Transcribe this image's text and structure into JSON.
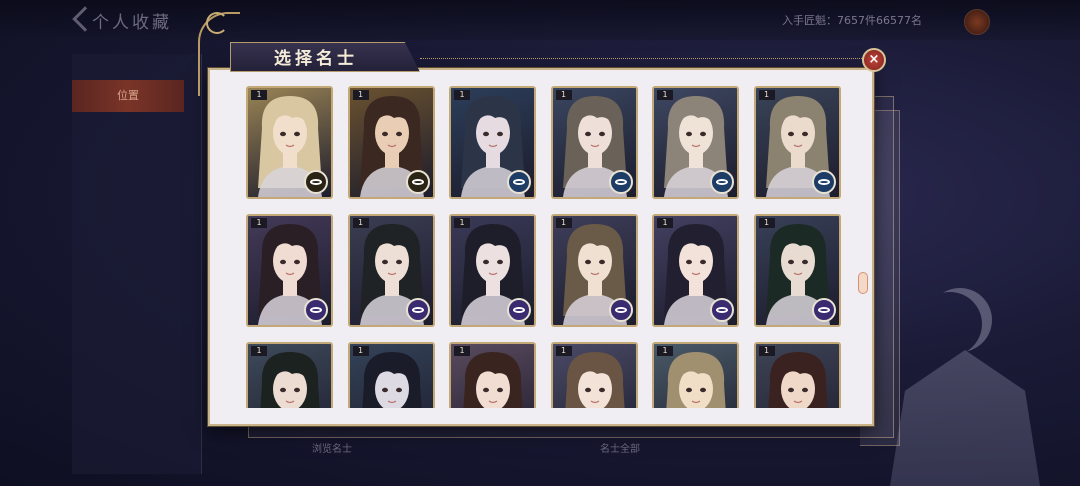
{
  "background": {
    "title": "个人收藏",
    "side_tab": "位置",
    "currency": "入手匠魁：7657件66577名",
    "bottom_left": "浏览名士",
    "bottom_mid": "名士全部"
  },
  "dialog": {
    "title": "选择名士",
    "close_label": "×"
  },
  "cards": [
    {
      "rank": "1",
      "hair": "#d8c7a0",
      "skin": "#f1dfcb",
      "bg": "#9a8455",
      "emblem": "gold"
    },
    {
      "rank": "1",
      "hair": "#3b2820",
      "skin": "#e9cdb4",
      "bg": "#6a5230",
      "emblem": "gold"
    },
    {
      "rank": "1",
      "hair": "#2c3448",
      "skin": "#e6dbe0",
      "bg": "#2c3e5a",
      "emblem": "blue"
    },
    {
      "rank": "1",
      "hair": "#6a6258",
      "skin": "#eee0d8",
      "bg": "#3a4660",
      "emblem": "blue"
    },
    {
      "rank": "1",
      "hair": "#8c8478",
      "skin": "#efe2d6",
      "bg": "#3e4862",
      "emblem": "blue"
    },
    {
      "rank": "1",
      "hair": "#8c8270",
      "skin": "#eadbcc",
      "bg": "#3a4458",
      "emblem": "blue"
    },
    {
      "rank": "1",
      "hair": "#2b1f26",
      "skin": "#f0dcd2",
      "bg": "#443a58",
      "emblem": "purple"
    },
    {
      "rank": "1",
      "hair": "#1f2326",
      "skin": "#eedfd6",
      "bg": "#3b3d52",
      "emblem": "purple"
    },
    {
      "rank": "1",
      "hair": "#1e1e2a",
      "skin": "#ece0e0",
      "bg": "#3a3a58",
      "emblem": "purple"
    },
    {
      "rank": "1",
      "hair": "#6a5a48",
      "skin": "#f0e0d2",
      "bg": "#3e3e5a",
      "emblem": "purple"
    },
    {
      "rank": "1",
      "hair": "#222030",
      "skin": "#f2e2da",
      "bg": "#444062",
      "emblem": "purple"
    },
    {
      "rank": "1",
      "hair": "#1c2a26",
      "skin": "#e8dcd2",
      "bg": "#384058",
      "emblem": "purple"
    },
    {
      "rank": "1",
      "hair": "#1c2220",
      "skin": "#eddcd2",
      "bg": "#3e4a5a",
      "emblem": "purple"
    },
    {
      "rank": "1",
      "hair": "#1a1c2a",
      "skin": "#dedae4",
      "bg": "#344258",
      "emblem": "purple"
    },
    {
      "rank": "1",
      "hair": "#3a2420",
      "skin": "#f2ddd2",
      "bg": "#5a4a5e",
      "emblem": "purple"
    },
    {
      "rank": "1",
      "hair": "#6a5444",
      "skin": "#f3e2d8",
      "bg": "#4a4a66",
      "emblem": "purple"
    },
    {
      "rank": "1",
      "hair": "#a09070",
      "skin": "#f0dfc6",
      "bg": "#4a5a68",
      "emblem": "purple"
    },
    {
      "rank": "1",
      "hair": "#3a2220",
      "skin": "#efd8c8",
      "bg": "#3e4456",
      "emblem": "purple"
    }
  ],
  "emblem_colors": {
    "gold": "#2a2416",
    "blue": "#1e3d66",
    "purple": "#3a2a70"
  },
  "colors": {
    "panel": "#f1eef3",
    "border_gold": "#c3a977",
    "close_red": "#c0443a"
  }
}
